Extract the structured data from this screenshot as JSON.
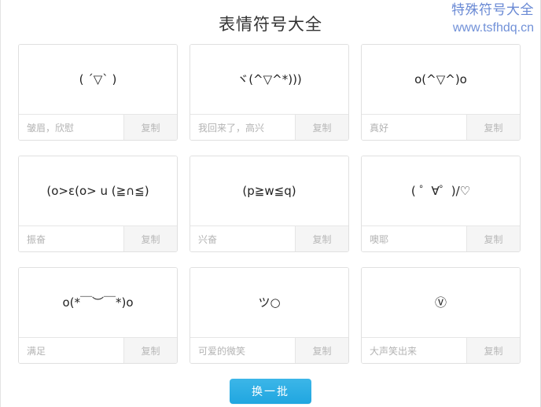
{
  "header": {
    "title": "表情符号大全",
    "watermark_cn": "特殊符号大全",
    "watermark_url": "www.tsfhdq.cn"
  },
  "cards": [
    {
      "emoticon": "( ˊ▽ˋ )",
      "label": "皱眉，欣慰",
      "button": "复制"
    },
    {
      "emoticon": "ヾ(^▽^*)))",
      "label": "我回来了，高兴",
      "button": "复制"
    },
    {
      "emoticon": "o(^▽^)o",
      "label": "真好",
      "button": "复制"
    },
    {
      "emoticon": "(o>ε(o> u (≧∩≦)",
      "label": "振奋",
      "button": "复制"
    },
    {
      "emoticon": "(p≧w≦q)",
      "label": "兴奋",
      "button": "复制"
    },
    {
      "emoticon": "( ゜∀゜)/♡",
      "label": "噢耶",
      "button": "复制"
    },
    {
      "emoticon": "o(*￣︶￣*)o",
      "label": "满足",
      "button": "复制"
    },
    {
      "emoticon": "ツ○",
      "label": "可爱的微笑",
      "button": "复制"
    },
    {
      "emoticon": "Ⓥ",
      "label": "大声笑出来",
      "button": "复制"
    }
  ],
  "footer": {
    "refresh_label": "换一批"
  },
  "colors": {
    "title": "#333333",
    "watermark": "#6989d4",
    "card_border": "#e0e0e0",
    "label_text": "#b3b3b3",
    "copy_bg": "#f5f5f5",
    "button_blue": "#29ace3"
  }
}
